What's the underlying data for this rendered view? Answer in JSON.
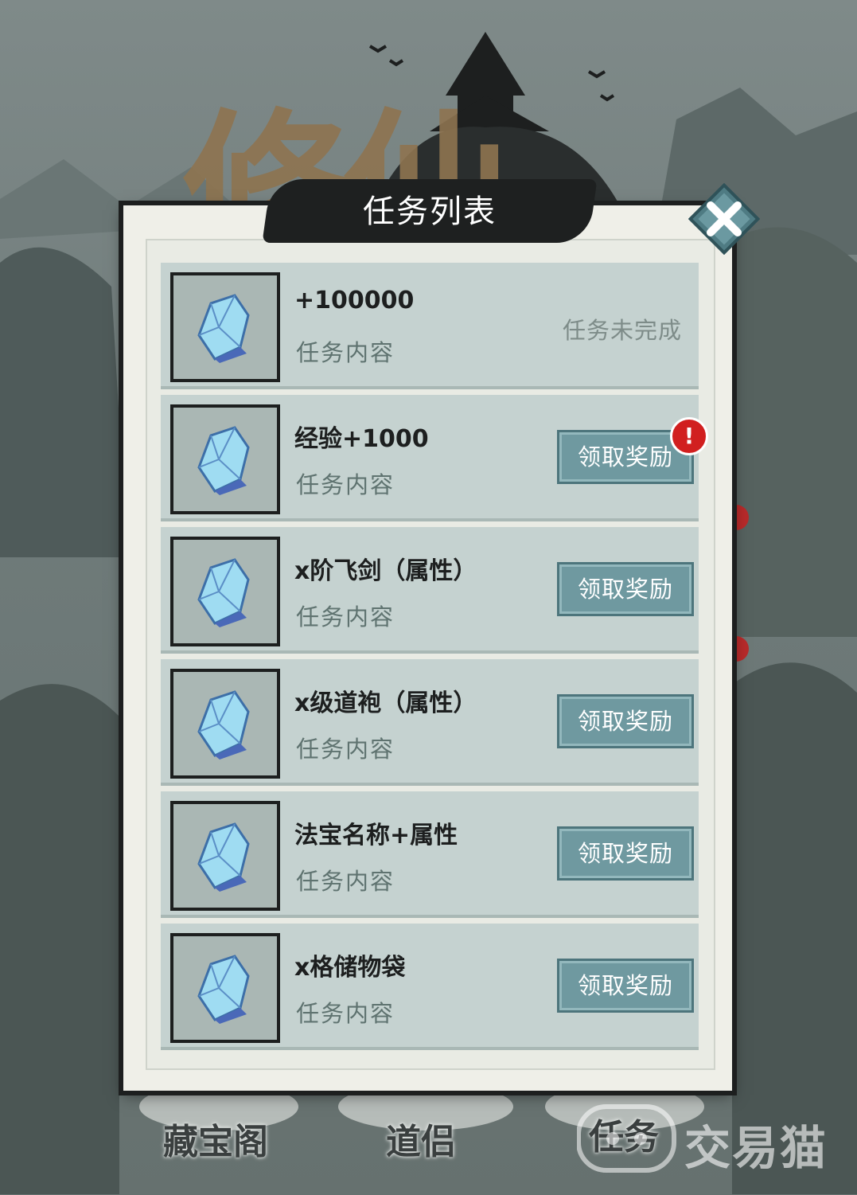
{
  "background": {
    "title_text": "修仙",
    "colors": {
      "ink": "#1d1f1f",
      "mountain": "#5f6b69",
      "sky": "#7f8a89"
    }
  },
  "dialog": {
    "title": "任务列表",
    "close_icon": "close-x-icon"
  },
  "tasks": [
    {
      "name": "+100000",
      "desc": "任务内容",
      "status": "任务未完成",
      "button_label": "",
      "has_alert": false,
      "icon": "crystal-icon"
    },
    {
      "name": "经验+1000",
      "desc": "任务内容",
      "status": "",
      "button_label": "领取奖励",
      "has_alert": true,
      "alert_glyph": "!",
      "icon": "crystal-icon"
    },
    {
      "name": "x阶飞剑（属性）",
      "desc": "任务内容",
      "status": "",
      "button_label": "领取奖励",
      "has_alert": false,
      "icon": "crystal-icon"
    },
    {
      "name": "x级道袍（属性）",
      "desc": "任务内容",
      "status": "",
      "button_label": "领取奖励",
      "has_alert": false,
      "icon": "crystal-icon"
    },
    {
      "name": "法宝名称+属性",
      "desc": "任务内容",
      "status": "",
      "button_label": "领取奖励",
      "has_alert": false,
      "icon": "crystal-icon"
    },
    {
      "name": "x格储物袋",
      "desc": "任务内容",
      "status": "",
      "button_label": "领取奖励",
      "has_alert": false,
      "icon": "crystal-icon"
    }
  ],
  "bottom_nav": {
    "treasure": "藏宝阁",
    "partner": "道侣",
    "tasks": "任务"
  },
  "watermark": {
    "text": "交易猫"
  }
}
